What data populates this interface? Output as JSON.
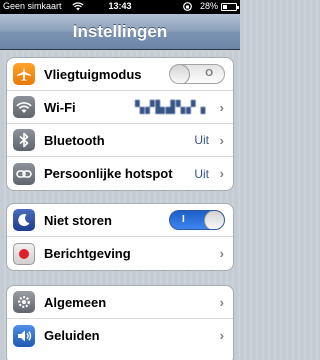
{
  "status_bar": {
    "carrier": "Geen simkaart",
    "time": "13:43",
    "battery": "28%",
    "battery_level": 0.28
  },
  "nav": {
    "title": "Instellingen"
  },
  "groups": [
    {
      "rows": [
        {
          "label": "Vliegtuigmodus",
          "icon": "airplane-icon",
          "toggle_state": "off"
        },
        {
          "label": "Wi-Fi",
          "icon": "wifi-icon",
          "value": "▚▞▙▟▚▞ ▖"
        },
        {
          "label": "Bluetooth",
          "icon": "bluetooth-icon",
          "value": "Uit"
        },
        {
          "label": "Persoonlijke hotspot",
          "icon": "hotspot-icon",
          "value": "Uit"
        }
      ]
    },
    {
      "rows": [
        {
          "label": "Niet storen",
          "icon": "moon-icon",
          "toggle_state": "on"
        },
        {
          "label": "Berichtgeving",
          "icon": "notifications-icon"
        }
      ]
    },
    {
      "rows": [
        {
          "label": "Algemeen",
          "icon": "gear-icon"
        },
        {
          "label": "Geluiden",
          "icon": "speaker-icon"
        }
      ]
    }
  ],
  "colors": {
    "nav_bar": "#6d86a8",
    "value_text": "#385487",
    "toggle_on": "#3d86f0"
  }
}
